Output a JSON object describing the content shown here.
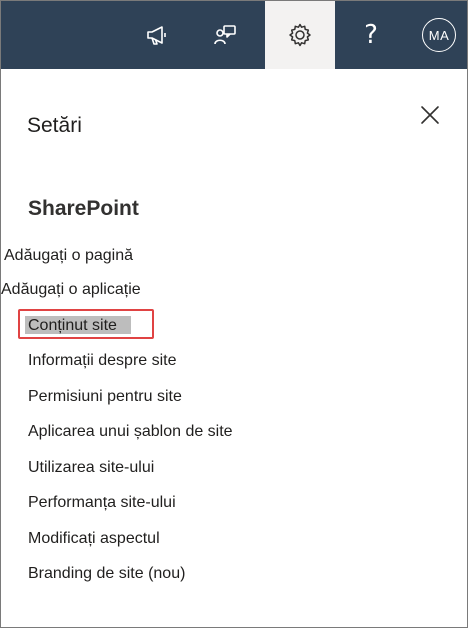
{
  "topbar": {
    "icons": [
      "megaphone-icon",
      "chat-feedback-icon",
      "gear-icon",
      "help-icon"
    ],
    "help_glyph": "?",
    "avatar_initials": "MA",
    "colors": {
      "background": "#2f4257",
      "active_tab": "#f3f2f1"
    }
  },
  "panel": {
    "title": "Setări",
    "section_title": "SharePoint",
    "items": [
      {
        "label": "Adăugați o pagină"
      },
      {
        "label": "Adăugați o aplicație"
      },
      {
        "label": "Conținut site"
      },
      {
        "label": "Informații despre site"
      },
      {
        "label": "Permisiuni pentru site"
      },
      {
        "label": "Aplicarea unui șablon de site"
      },
      {
        "label": "Utilizarea site-ului"
      },
      {
        "label": "Performanța site-ului"
      },
      {
        "label": "Modificați aspectul"
      },
      {
        "label": "Branding de site (nou)"
      }
    ],
    "highlight_color": "#e04343"
  }
}
